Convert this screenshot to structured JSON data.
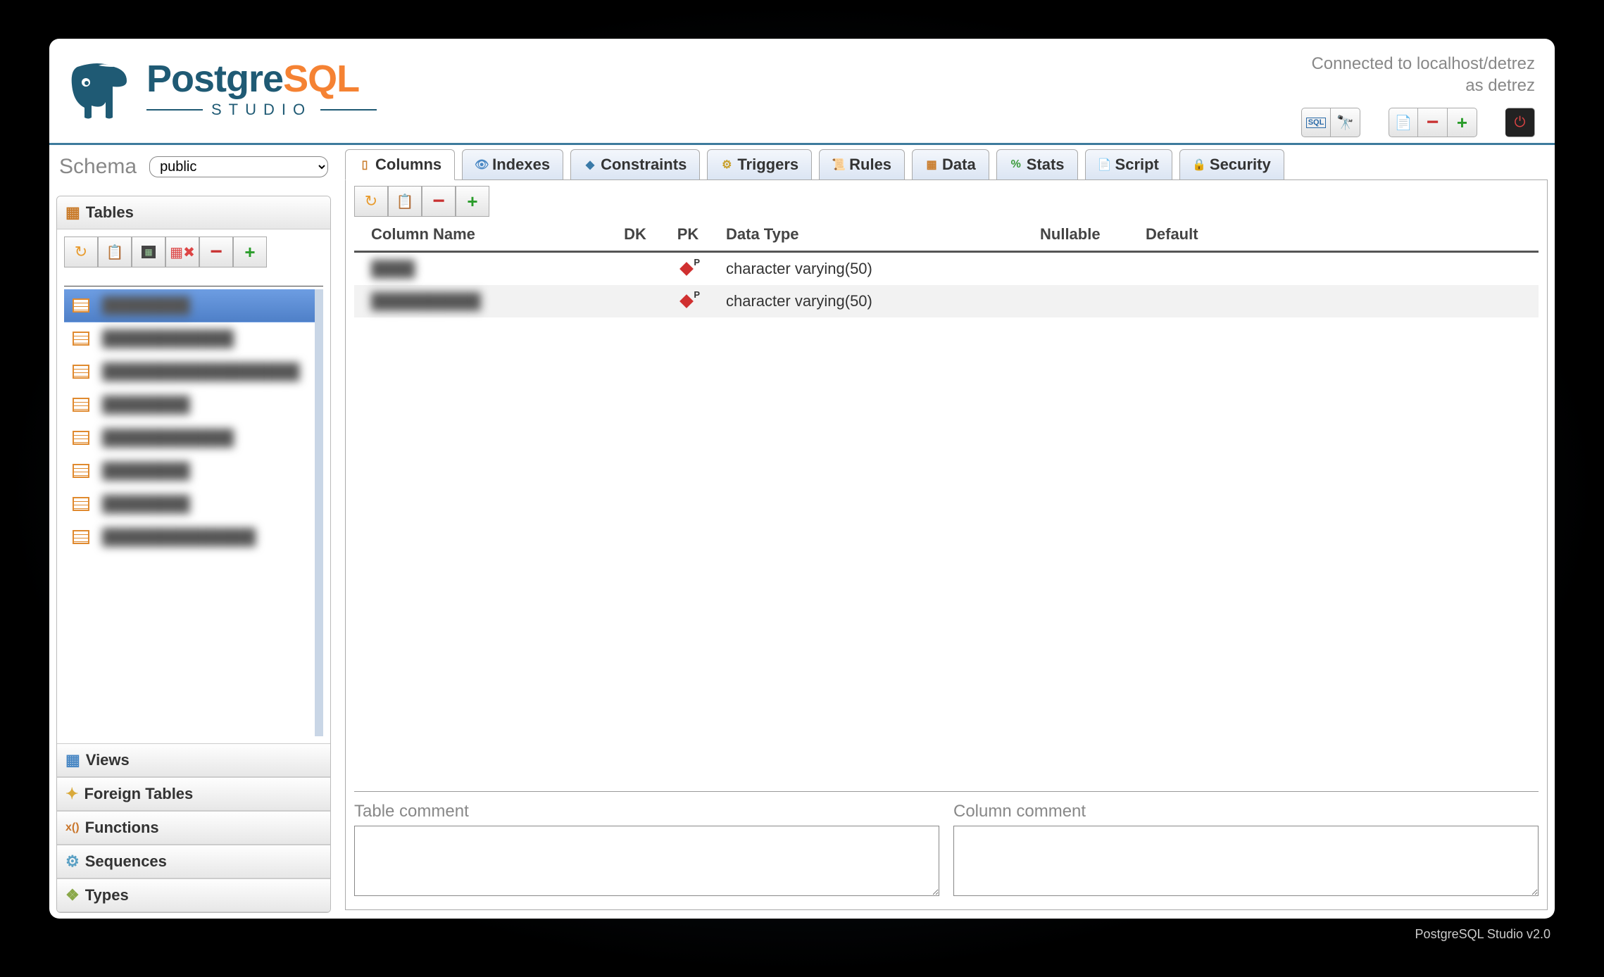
{
  "logo": {
    "pg": "Postgre",
    "sql": "SQL",
    "sub": "STUDIO"
  },
  "connection": {
    "line1": "Connected to localhost/detrez",
    "line2": "as detrez"
  },
  "schema": {
    "label": "Schema",
    "selected": "public"
  },
  "sidebar": {
    "sections": [
      {
        "label": "Tables",
        "expanded": true
      },
      {
        "label": "Views"
      },
      {
        "label": "Foreign Tables"
      },
      {
        "label": "Functions"
      },
      {
        "label": "Sequences"
      },
      {
        "label": "Types"
      }
    ],
    "tables": [
      {
        "name": "████████",
        "selected": true
      },
      {
        "name": "████████████"
      },
      {
        "name": "██████████████████"
      },
      {
        "name": "████████"
      },
      {
        "name": "████████████"
      },
      {
        "name": "████████"
      },
      {
        "name": "████████"
      },
      {
        "name": "██████████████"
      }
    ]
  },
  "tabs": [
    {
      "label": "Columns",
      "active": true
    },
    {
      "label": "Indexes"
    },
    {
      "label": "Constraints"
    },
    {
      "label": "Triggers"
    },
    {
      "label": "Rules"
    },
    {
      "label": "Data"
    },
    {
      "label": "Stats"
    },
    {
      "label": "Script"
    },
    {
      "label": "Security"
    }
  ],
  "columns_grid": {
    "headers": {
      "name": "Column Name",
      "dk": "DK",
      "pk": "PK",
      "type": "Data Type",
      "nullable": "Nullable",
      "default": "Default"
    },
    "rows": [
      {
        "name": "████",
        "dk": "",
        "pk": true,
        "type": "character varying(50)",
        "nullable": "",
        "default": ""
      },
      {
        "name": "██████████",
        "dk": "",
        "pk": true,
        "type": "character varying(50)",
        "nullable": "",
        "default": ""
      }
    ]
  },
  "comments": {
    "table_label": "Table comment",
    "column_label": "Column comment",
    "table_value": "",
    "column_value": ""
  },
  "footer": "PostgreSQL Studio v2.0"
}
